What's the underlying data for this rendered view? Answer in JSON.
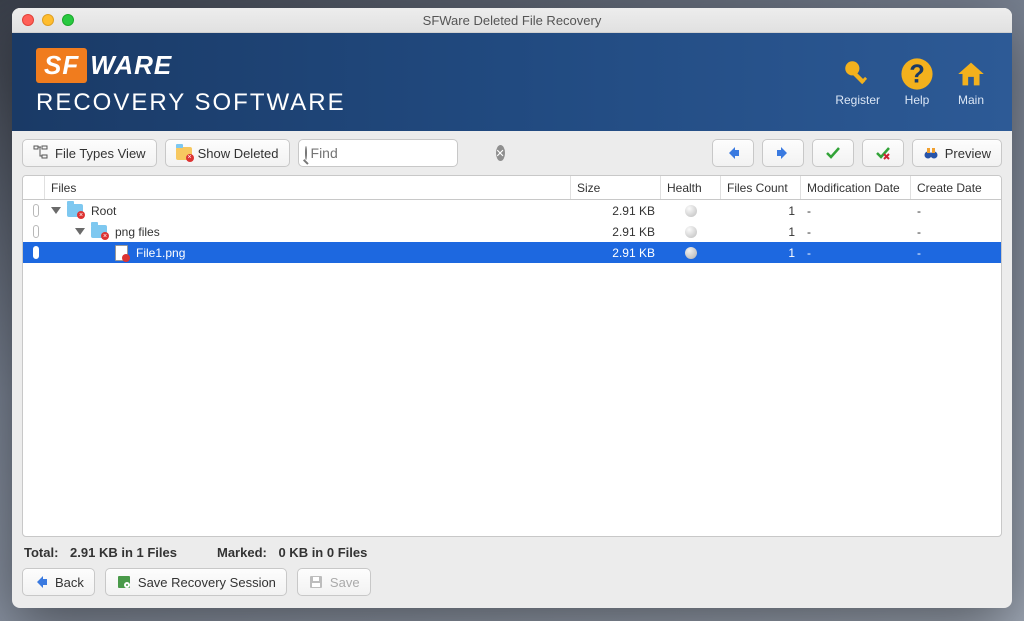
{
  "window": {
    "title": "SFWare Deleted File Recovery"
  },
  "banner": {
    "logo_badge": "SF",
    "logo_word": "WARE",
    "logo_sub": "RECOVERY SOFTWARE",
    "actions": {
      "register": "Register",
      "help": "Help",
      "main": "Main"
    }
  },
  "toolbar": {
    "file_types_view": "File Types View",
    "show_deleted": "Show Deleted",
    "search_placeholder": "Find",
    "preview": "Preview"
  },
  "columns": {
    "files": "Files",
    "size": "Size",
    "health": "Health",
    "files_count": "Files Count",
    "mod_date": "Modification Date",
    "create_date": "Create Date"
  },
  "rows": [
    {
      "indent": 0,
      "expand": true,
      "type": "folder",
      "name": "Root",
      "size": "2.91 KB",
      "health": true,
      "count": "1",
      "mod": "-",
      "create": "-",
      "selected": false
    },
    {
      "indent": 1,
      "expand": true,
      "type": "folder",
      "name": "png files",
      "size": "2.91 KB",
      "health": true,
      "count": "1",
      "mod": "-",
      "create": "-",
      "selected": false
    },
    {
      "indent": 2,
      "expand": false,
      "type": "file",
      "name": "File1.png",
      "size": "2.91 KB",
      "health": true,
      "count": "1",
      "mod": "-",
      "create": "-",
      "selected": true
    }
  ],
  "status": {
    "total_label": "Total:",
    "total_value": "2.91 KB in 1 Files",
    "marked_label": "Marked:",
    "marked_value": "0 KB in 0 Files"
  },
  "bottom": {
    "back": "Back",
    "save_session": "Save Recovery Session",
    "save": "Save"
  }
}
